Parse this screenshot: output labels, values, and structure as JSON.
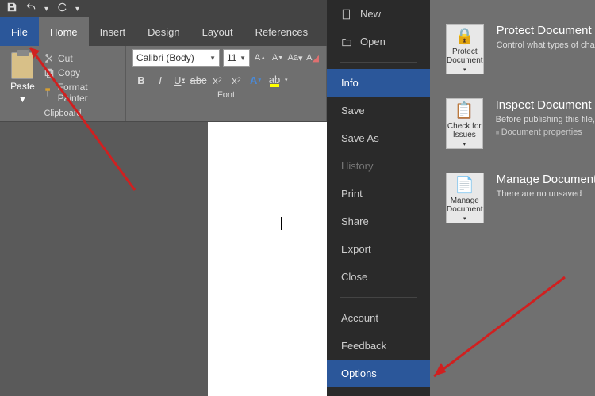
{
  "qat": {
    "save": "save-icon",
    "undo": "undo-icon",
    "redo": "redo-icon"
  },
  "tabs": {
    "file": "File",
    "home": "Home",
    "insert": "Insert",
    "design": "Design",
    "layout": "Layout",
    "references": "References"
  },
  "clipboard": {
    "paste": "Paste",
    "cut": "Cut",
    "copy": "Copy",
    "format_painter": "Format Painter",
    "group_label": "Clipboard"
  },
  "font": {
    "name": "Calibri (Body)",
    "size": "11",
    "group_label": "Font"
  },
  "backstage": {
    "new": "New",
    "open": "Open",
    "info": "Info",
    "save": "Save",
    "save_as": "Save As",
    "history": "History",
    "print": "Print",
    "share": "Share",
    "export": "Export",
    "close": "Close",
    "account": "Account",
    "feedback": "Feedback",
    "options": "Options"
  },
  "info_panel": {
    "protect": {
      "tile": "Protect Document",
      "heading": "Protect Document",
      "desc": "Control what types of changes"
    },
    "inspect": {
      "tile": "Check for Issues",
      "heading": "Inspect Document",
      "desc": "Before publishing this file,",
      "bullet": "Document properties"
    },
    "manage": {
      "tile": "Manage Document",
      "heading": "Manage Document",
      "desc": "There are no unsaved"
    }
  }
}
